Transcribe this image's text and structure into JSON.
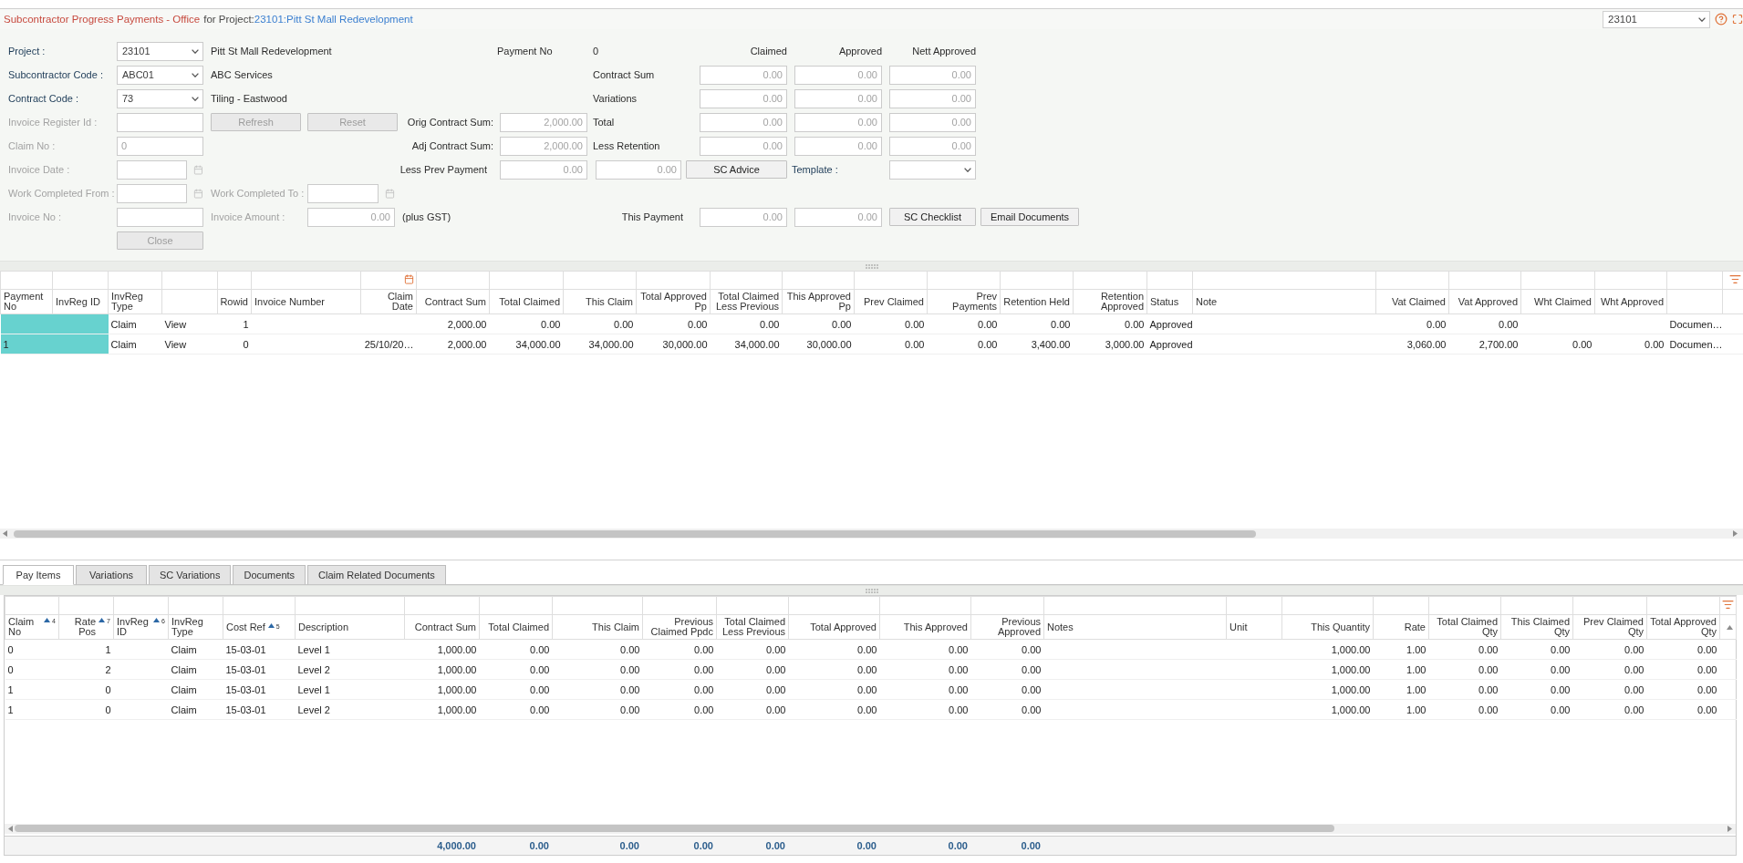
{
  "title_bar": {
    "title": "Subcontractor Progress Payments - Office",
    "for_label": "for Project:",
    "project_link": "23101:Pitt St Mall Redevelopment",
    "project_select": "23101"
  },
  "form": {
    "left_fields": [
      {
        "label": "Project :",
        "kind": "select",
        "value": "23101",
        "description": "Pitt St Mall Redevelopment",
        "disabled": false
      },
      {
        "label": "Subcontractor Code :",
        "kind": "select",
        "value": "ABC01",
        "description": "ABC Services",
        "disabled": false
      },
      {
        "label": "Contract Code :",
        "kind": "select",
        "value": "73",
        "description": "Tiling - Eastwood",
        "disabled": false
      },
      {
        "label": "Invoice Register Id :",
        "kind": "text",
        "disabled": true
      },
      {
        "label": "Claim No :",
        "kind": "text",
        "value": "0",
        "disabled": true
      },
      {
        "label": "Invoice Date :",
        "kind": "date",
        "disabled": true
      },
      {
        "label": "Work Completed From :",
        "kind": "date",
        "disabled": true
      },
      {
        "label": "Invoice No :",
        "kind": "text",
        "disabled": true
      }
    ],
    "work_completed_to": {
      "label": "Work Completed To :",
      "disabled": true
    },
    "invoice_amount": {
      "label": "Invoice Amount :",
      "value": "0.00",
      "note": "(plus GST)",
      "disabled": true
    },
    "buttons": [
      {
        "label": "Refresh",
        "disabled": true
      },
      {
        "label": "Reset",
        "disabled": true
      },
      {
        "label": "Close",
        "disabled": true
      }
    ],
    "payment_no": {
      "label": "Payment No",
      "value": "0"
    },
    "contract_sums": [
      {
        "label": "Orig Contract Sum:",
        "values": [
          "2,000.00"
        ]
      },
      {
        "label": "Adj Contract Sum:",
        "values": [
          "2,000.00"
        ]
      },
      {
        "label": "Less Prev Payment",
        "values": [
          "0.00",
          "0.00"
        ]
      }
    ],
    "summary": {
      "columns": [
        "Claimed",
        "Approved",
        "Nett Approved"
      ],
      "rows": [
        {
          "label": "Contract Sum",
          "values": [
            "0.00",
            "0.00",
            "0.00"
          ]
        },
        {
          "label": "Variations",
          "values": [
            "0.00",
            "0.00",
            "0.00"
          ]
        },
        {
          "label": "Total",
          "values": [
            "0.00",
            "0.00",
            "0.00"
          ]
        },
        {
          "label": "Less Retention",
          "values": [
            "0.00",
            "0.00",
            "0.00"
          ]
        }
      ]
    },
    "sc_advice_button": {
      "label": "SC Advice",
      "disabled": false
    },
    "template": {
      "label": "Template :"
    },
    "this_payment": {
      "label": "This Payment",
      "values": [
        "0.00",
        "0.00"
      ]
    },
    "action_buttons": [
      {
        "label": "SC Checklist",
        "disabled": false
      },
      {
        "label": "Email Documents",
        "disabled": false
      }
    ]
  },
  "payments_grid": {
    "columns": [
      {
        "label": "Payment No",
        "kind": "text"
      },
      {
        "label": "InvReg ID",
        "kind": "text"
      },
      {
        "label": "InvReg Type",
        "kind": "text"
      },
      {
        "kind": "link"
      },
      {
        "label": "Rowid",
        "kind": "number"
      },
      {
        "label": "Invoice Number",
        "kind": "text"
      },
      {
        "label": "Claim Date",
        "kind": "date"
      },
      {
        "label": "Contract Sum",
        "kind": "number"
      },
      {
        "label": "Total Claimed",
        "kind": "number"
      },
      {
        "label": "This Claim",
        "kind": "number"
      },
      {
        "label": "Total Approved Pp",
        "kind": "number"
      },
      {
        "label": "Total Claimed Less Previous",
        "kind": "number"
      },
      {
        "label": "This Approved Pp",
        "kind": "number"
      },
      {
        "label": "Prev Claimed",
        "kind": "number"
      },
      {
        "label": "Prev Payments",
        "kind": "number"
      },
      {
        "label": "Retention Held",
        "kind": "number"
      },
      {
        "label": "Retention Approved",
        "kind": "number"
      },
      {
        "label": "Status",
        "kind": "text"
      },
      {
        "label": "Note",
        "kind": "text"
      },
      {
        "label": "Vat Claimed",
        "kind": "number"
      },
      {
        "label": "Vat Approved",
        "kind": "number"
      },
      {
        "label": "Wht Claimed",
        "kind": "number"
      },
      {
        "label": "Wht Approved",
        "kind": "number"
      },
      {
        "kind": "text"
      }
    ],
    "rows": [
      [
        null,
        null,
        "Claim",
        "View",
        "1",
        null,
        null,
        "2,000.00",
        "0.00",
        "0.00",
        "0.00",
        "0.00",
        "0.00",
        "0.00",
        "0.00",
        "0.00",
        "0.00",
        "Approved",
        null,
        "0.00",
        "0.00",
        null,
        null,
        "Documen…"
      ],
      [
        "1",
        null,
        "Claim",
        "View",
        "0",
        null,
        "25/10/20…",
        "2,000.00",
        "34,000.00",
        "34,000.00",
        "30,000.00",
        "34,000.00",
        "30,000.00",
        "0.00",
        "0.00",
        "3,400.00",
        "3,000.00",
        "Approved",
        null,
        "3,060.00",
        "2,700.00",
        "0.00",
        "0.00",
        "Documen…"
      ]
    ]
  },
  "tabs": [
    {
      "label": "Pay Items",
      "selected": true
    },
    {
      "label": "Variations",
      "selected": false
    },
    {
      "label": "SC Variations",
      "selected": false
    },
    {
      "label": "Documents",
      "selected": false
    },
    {
      "label": "Claim Related Documents",
      "selected": false
    }
  ],
  "items_grid": {
    "columns": [
      {
        "label": "Claim No",
        "kind": "text",
        "sort_order": "4"
      },
      {
        "label": "Rate Pos",
        "kind": "number",
        "sort_order": "7"
      },
      {
        "label": "InvReg ID",
        "kind": "text",
        "sort_order": "6"
      },
      {
        "label": "InvReg Type",
        "kind": "text"
      },
      {
        "label": "Cost Ref",
        "kind": "text",
        "sort_order": "5"
      },
      {
        "label": "Description",
        "kind": "text"
      },
      {
        "label": "Contract Sum",
        "kind": "number",
        "total": "4,000.00"
      },
      {
        "label": "Total Claimed",
        "kind": "number",
        "total": "0.00"
      },
      {
        "label": "This Claim",
        "kind": "number",
        "total": "0.00"
      },
      {
        "label": "Previous Claimed Ppdc",
        "kind": "number",
        "total": "0.00"
      },
      {
        "label": "Total Claimed Less Previous",
        "kind": "number",
        "total": "0.00"
      },
      {
        "label": "Total Approved",
        "kind": "number",
        "total": "0.00"
      },
      {
        "label": "This Approved",
        "kind": "number",
        "total": "0.00"
      },
      {
        "label": "Previous Approved",
        "kind": "number",
        "total": "0.00"
      },
      {
        "label": "Notes",
        "kind": "text"
      },
      {
        "label": "Unit",
        "kind": "text"
      },
      {
        "label": "This Quantity",
        "kind": "number"
      },
      {
        "label": "Rate",
        "kind": "number"
      },
      {
        "label": "Total Claimed Qty",
        "kind": "number"
      },
      {
        "label": "This Claimed Qty",
        "kind": "number"
      },
      {
        "label": "Prev Claimed Qty",
        "kind": "number"
      },
      {
        "label": "Total Approved Qty",
        "kind": "number"
      }
    ],
    "rows": [
      [
        "0",
        "1",
        null,
        "Claim",
        "15-03-01",
        "Level 1",
        "1,000.00",
        "0.00",
        "0.00",
        "0.00",
        "0.00",
        "0.00",
        "0.00",
        "0.00",
        null,
        null,
        "1,000.00",
        "1.00",
        "0.00",
        "0.00",
        "0.00",
        "0.00"
      ],
      [
        "0",
        "2",
        null,
        "Claim",
        "15-03-01",
        "Level 2",
        "1,000.00",
        "0.00",
        "0.00",
        "0.00",
        "0.00",
        "0.00",
        "0.00",
        "0.00",
        null,
        null,
        "1,000.00",
        "1.00",
        "0.00",
        "0.00",
        "0.00",
        "0.00"
      ],
      [
        "1",
        "0",
        null,
        "Claim",
        "15-03-01",
        "Level 1",
        "1,000.00",
        "0.00",
        "0.00",
        "0.00",
        "0.00",
        "0.00",
        "0.00",
        "0.00",
        null,
        null,
        "1,000.00",
        "1.00",
        "0.00",
        "0.00",
        "0.00",
        "0.00"
      ],
      [
        "1",
        "0",
        null,
        "Claim",
        "15-03-01",
        "Level 2",
        "1,000.00",
        "0.00",
        "0.00",
        "0.00",
        "0.00",
        "0.00",
        "0.00",
        "0.00",
        null,
        null,
        "1,000.00",
        "1.00",
        "0.00",
        "0.00",
        "0.00",
        "0.00"
      ]
    ]
  }
}
